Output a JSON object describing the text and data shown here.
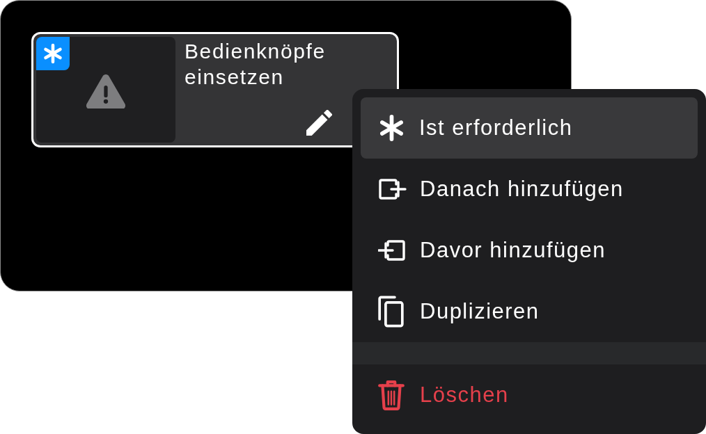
{
  "card": {
    "title": "Bedienknöpfe einsetzen",
    "required": true
  },
  "context_menu": {
    "groups": [
      {
        "items": [
          {
            "kind": "required",
            "label": "Ist erforderlich",
            "selected": true
          },
          {
            "kind": "add_after",
            "label": "Danach hinzufügen",
            "selected": false
          },
          {
            "kind": "add_before",
            "label": "Davor hinzufügen",
            "selected": false
          },
          {
            "kind": "duplicate",
            "label": "Duplizieren",
            "selected": false
          }
        ]
      },
      {
        "items": [
          {
            "kind": "delete",
            "label": "Löschen",
            "selected": false
          }
        ]
      }
    ]
  }
}
